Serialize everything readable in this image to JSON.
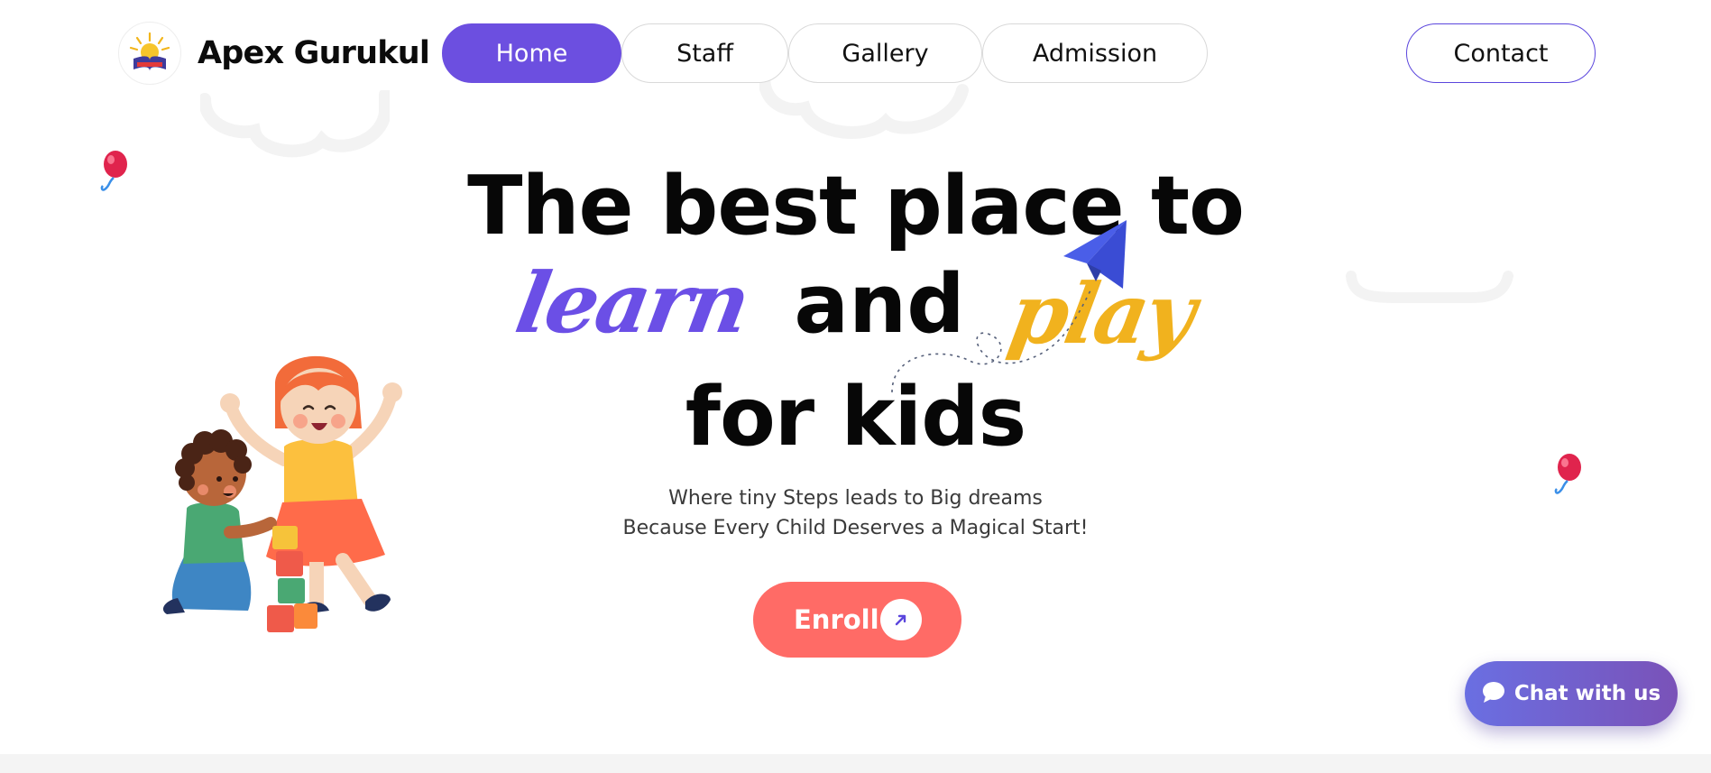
{
  "header": {
    "brand_name": "Apex Gurukul",
    "logo_icon": "school-sun-book-logo",
    "logo_text": "APEX GURUKUL",
    "nav": [
      {
        "label": "Home",
        "active": true
      },
      {
        "label": "Staff",
        "active": false
      },
      {
        "label": "Gallery",
        "active": false
      },
      {
        "label": "Admission",
        "active": false
      }
    ],
    "contact_label": "Contact"
  },
  "hero": {
    "line1": "The best place to",
    "word_learn": "learn",
    "word_and": "and",
    "word_play": "play",
    "line3": "for kids",
    "subtitle_1": "Where tiny Steps leads to Big dreams",
    "subtitle_2": "Because Every Child Deserves a Magical Start!",
    "enroll_label": "Enroll",
    "enroll_icon": "arrow-up-right-icon"
  },
  "chat": {
    "label": "Chat with us",
    "icon": "chat-bubble-icon"
  },
  "decor": {
    "balloon_icon": "balloon-icon",
    "plane_icon": "paper-plane-icon",
    "illustration": "kids-playing-blocks-illustration"
  },
  "colors": {
    "accent_purple": "#6c4fe0",
    "learn_purple": "#6b4fe6",
    "play_yellow": "#f1b21e",
    "enroll_coral": "#ff6b66",
    "chat_gradient_start": "#6a6fe2",
    "chat_gradient_end": "#7a52b8",
    "plane_blue": "#4a5ee8"
  }
}
